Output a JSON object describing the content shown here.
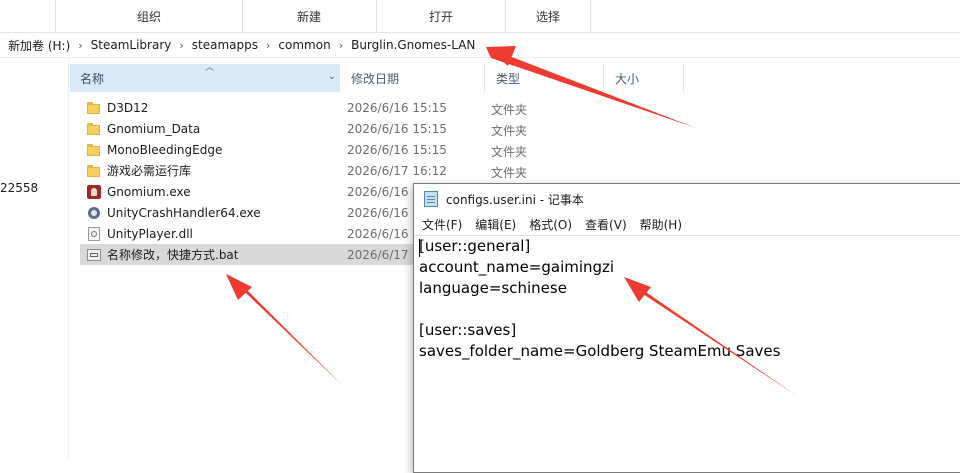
{
  "ribbon": {
    "organize": "组织",
    "new": "新建",
    "open": "打开",
    "select": "选择"
  },
  "breadcrumb": [
    "新加卷 (H:)",
    "SteamLibrary",
    "steamapps",
    "common",
    "Burglin.Gnomes-LAN"
  ],
  "nav_fragment": "22558",
  "columns": {
    "name": "名称",
    "date": "修改日期",
    "type": "类型",
    "size": "大小"
  },
  "files": [
    {
      "name": "D3D12",
      "date": "2026/6/16 15:15",
      "type": "文件夹",
      "icon": "folder-icon"
    },
    {
      "name": "Gnomium_Data",
      "date": "2026/6/16 15:15",
      "type": "文件夹",
      "icon": "folder-icon"
    },
    {
      "name": "MonoBleedingEdge",
      "date": "2026/6/16 15:15",
      "type": "文件夹",
      "icon": "folder-icon"
    },
    {
      "name": "游戏必需运行库",
      "date": "2026/6/17 16:12",
      "type": "文件夹",
      "icon": "folder-icon"
    },
    {
      "name": "Gnomium.exe",
      "date": "2026/6/16",
      "type": "",
      "icon": "game-exe-icon"
    },
    {
      "name": "UnityCrashHandler64.exe",
      "date": "2026/6/16",
      "type": "",
      "icon": "gear-exe-icon"
    },
    {
      "name": "UnityPlayer.dll",
      "date": "2026/6/16",
      "type": "",
      "icon": "dll-icon"
    },
    {
      "name": "名称修改，快捷方式.bat",
      "date": "2026/6/17",
      "type": "",
      "icon": "bat-icon"
    }
  ],
  "notepad": {
    "title": "configs.user.ini - 记事本",
    "menu": [
      "文件(F)",
      "编辑(E)",
      "格式(O)",
      "查看(V)",
      "帮助(H)"
    ],
    "lines": [
      "[user::general]",
      "account_name=gaimingzi",
      "language=schinese",
      "",
      "[user::saves]",
      "saves_folder_name=Goldberg SteamEmu Saves"
    ]
  },
  "colors": {
    "arrow": "#ee3b2f",
    "header_selected": "#d9ebf9",
    "row_selected": "#d9d9d9"
  }
}
